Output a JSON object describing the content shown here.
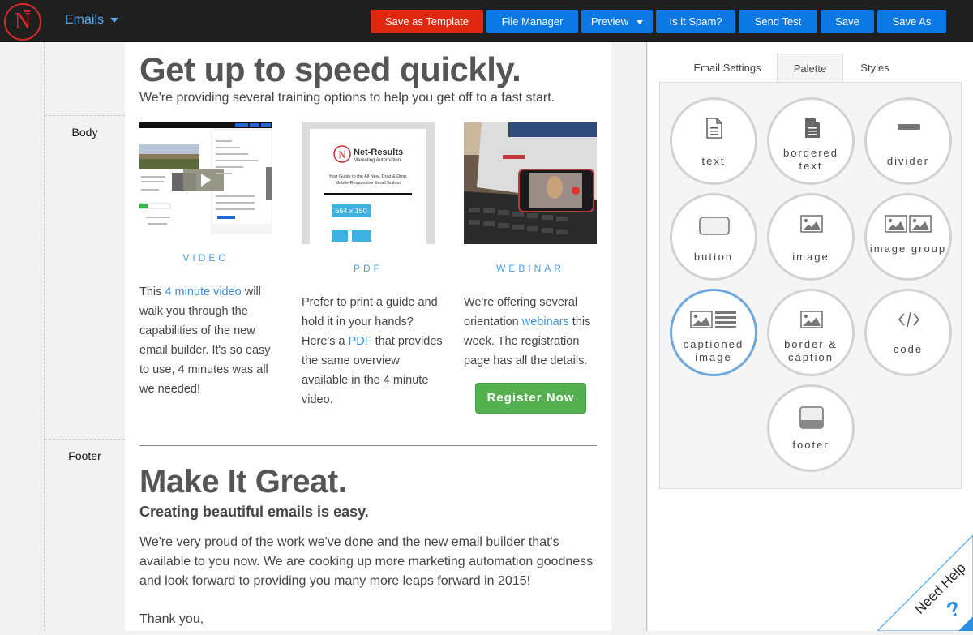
{
  "topbar": {
    "logo_letter": "N",
    "menu_label": "Emails",
    "buttons": {
      "save_template": "Save as Template",
      "file_manager": "File Manager",
      "preview": "Preview",
      "spam": "Is it Spam?",
      "send_test": "Send Test",
      "save": "Save",
      "save_as": "Save As"
    }
  },
  "sections": {
    "body": "Body",
    "footer": "Footer"
  },
  "email": {
    "title": "Get up to speed quickly.",
    "subtitle": "We're providing several training options to help you get off to a fast start.",
    "columns": [
      {
        "label": "VIDEO",
        "text_before": "This ",
        "link": "4 minute video",
        "text_after": " will walk you through the capabilities of the new email builder. It's so easy to use, 4 minutes was all we needed!"
      },
      {
        "label": "PDF",
        "text_before": "Prefer to print a guide and hold it in your hands? Here's a ",
        "link": "PDF",
        "text_after": " that provides the same overview available in the 4 minute video."
      },
      {
        "label": "WEBINAR",
        "text_before": "We're offering several orientation ",
        "link": "webinars",
        "text_after": " this week. The registration page has all the details."
      }
    ],
    "pdf_thumb": {
      "brand": "Net-Results",
      "brand_sub": "Marketing Automation",
      "guide_title": "Your Guide to the All New, Drag & Drop, Mobile-Responsive Email Builder",
      "placeholder": "564 x 150",
      "small_placeholder": "564 x 150"
    },
    "register_button": "Register Now",
    "title2": "Make It Great.",
    "subtitle2": "Creating beautiful emails is easy.",
    "paragraph": "We're very proud of the work we've done and the new email builder that's available to you now. We are cooking up more marketing automation goodness and look forward to providing you many more leaps forward in 2015!",
    "thanks": "Thank you,"
  },
  "panel": {
    "tabs": [
      "Email Settings",
      "Palette",
      "Styles"
    ],
    "active_tab": "Palette",
    "palette_items": [
      {
        "label": "text",
        "icon": "text-document-icon"
      },
      {
        "label": "bordered text",
        "icon": "filled-document-icon"
      },
      {
        "label": "divider",
        "icon": "divider-icon"
      },
      {
        "label": "button",
        "icon": "button-icon"
      },
      {
        "label": "image",
        "icon": "image-icon"
      },
      {
        "label": "image group",
        "icon": "image-group-icon"
      },
      {
        "label": "captioned image",
        "icon": "captioned-image-icon"
      },
      {
        "label": "border & caption",
        "icon": "border-caption-icon"
      },
      {
        "label": "code",
        "icon": "code-icon"
      },
      {
        "label": "footer",
        "icon": "footer-icon"
      }
    ],
    "selected_item": "captioned image"
  },
  "help": {
    "label": "Need Help",
    "icon": "?"
  },
  "colors": {
    "topbar_bg": "#1f1f1f",
    "primary_button": "#0b78e3",
    "danger_button": "#e0270f",
    "link": "#3a8fdc",
    "register_green": "#55b04f",
    "selected_ring": "#6fa8de"
  }
}
